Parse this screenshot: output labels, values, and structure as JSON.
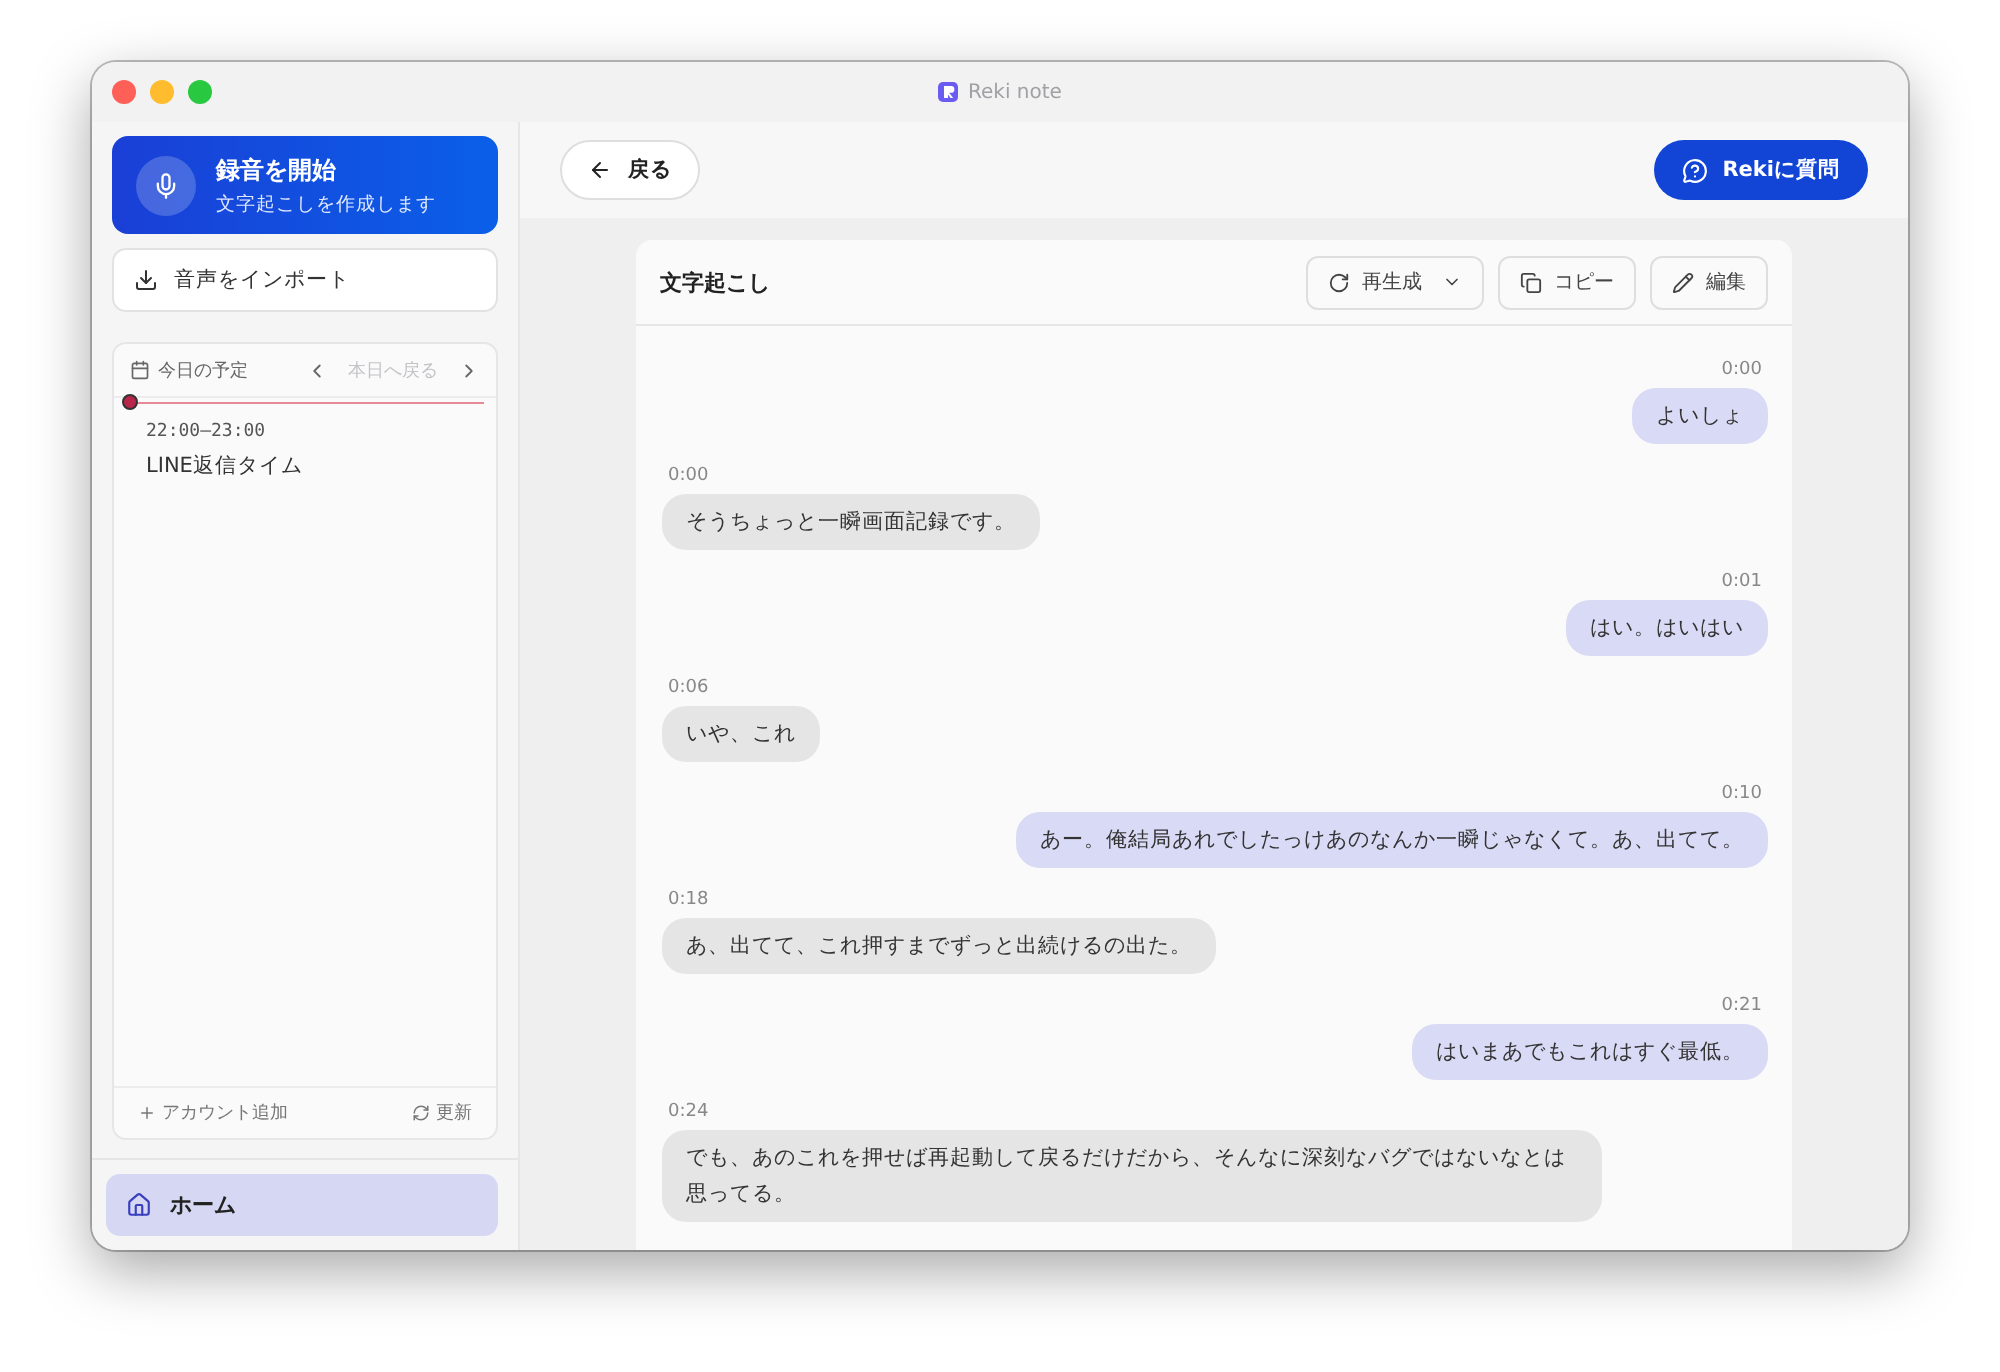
{
  "window": {
    "title": "Reki note"
  },
  "sidebar": {
    "record_button": {
      "title": "録音を開始",
      "subtitle": "文字起こしを作成します"
    },
    "import_button": {
      "label": "音声をインポート"
    },
    "schedule": {
      "title": "今日の予定",
      "today_button": {
        "label": "本日へ戻る",
        "disabled": true
      },
      "events": [
        {
          "time": "22:00–23:00",
          "title": "LINE返信タイム"
        }
      ],
      "add_account": "アカウント追加",
      "refresh": "更新"
    },
    "nav": [
      {
        "label": "ホーム",
        "selected": true
      }
    ]
  },
  "header": {
    "back_button": "戻る",
    "ask_button": "Rekiに質問"
  },
  "transcript": {
    "title": "文字起こし",
    "actions": [
      {
        "kind": "regenerate",
        "label": "再生成"
      },
      {
        "kind": "copy",
        "label": "コピー"
      },
      {
        "kind": "edit",
        "label": "編集"
      }
    ],
    "messages": [
      {
        "kind": "outgoing",
        "time": "0:00",
        "text": "よいしょ"
      },
      {
        "kind": "incoming",
        "time": "0:00",
        "text": "そうちょっと一瞬画面記録です。"
      },
      {
        "kind": "outgoing",
        "time": "0:01",
        "text": "はい。はいはい"
      },
      {
        "kind": "incoming",
        "time": "0:06",
        "text": "いや、これ"
      },
      {
        "kind": "outgoing",
        "time": "0:10",
        "text": "あー。俺結局あれでしたっけあのなんか一瞬じゃなくて。あ、出てて。"
      },
      {
        "kind": "incoming",
        "time": "0:18",
        "text": "あ、出てて、これ押すまでずっと出続けるの出た。"
      },
      {
        "kind": "outgoing",
        "time": "0:21",
        "text": "はいまあでもこれはすぐ最低。"
      },
      {
        "kind": "incoming",
        "time": "0:24",
        "text": "でも、あのこれを押せば再起動して戻るだけだから、そんなに深刻なバグではないなとは思ってる。"
      }
    ]
  }
}
